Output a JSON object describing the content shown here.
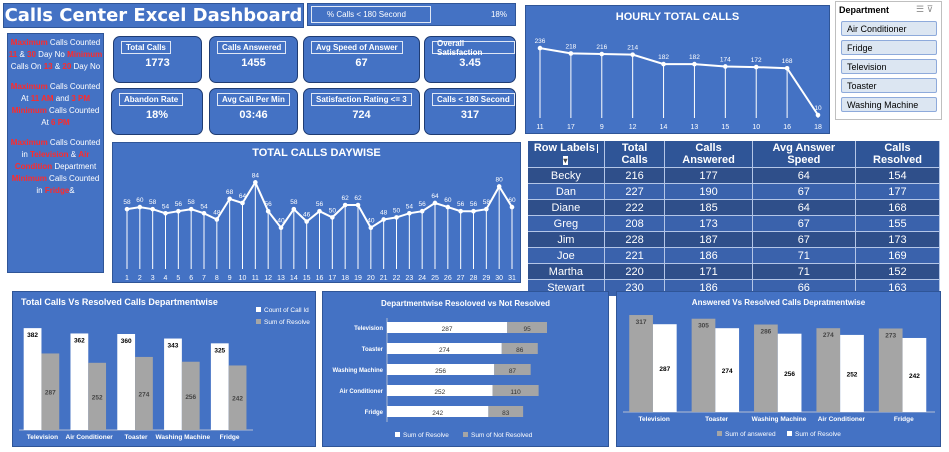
{
  "title": "Calls Center Excel Dashboard",
  "pct_bar": {
    "label": "% Calls < 180 Second",
    "value": "18%"
  },
  "notes": {
    "b1": [
      "Maximum",
      " Calls Counted ",
      "11",
      " & ",
      "30",
      " Day No ",
      "Minimum",
      " Calls On ",
      "13",
      " & ",
      "20",
      " Day No"
    ],
    "b2": [
      "Maximum",
      " Calls Counted At ",
      "11 AM",
      " and ",
      "3 PM",
      " ",
      "Minimum",
      " Calls Counted At ",
      "6 PM"
    ],
    "b3": [
      "Maximum",
      " Calls Counted in ",
      "Television",
      " & ",
      "Air Condition",
      " Department ",
      "Minimum",
      " Calls Counted in ",
      "Fridge",
      "&"
    ]
  },
  "kpis": [
    {
      "label": "Total Calls",
      "value": "1773"
    },
    {
      "label": "Calls Answered",
      "value": "1455"
    },
    {
      "label": "Avg Speed of Answer",
      "value": "67"
    },
    {
      "label": "Overall Satisfaction",
      "value": "3.45"
    },
    {
      "label": "Abandon Rate",
      "value": "18%"
    },
    {
      "label": "Avg Call Per Min",
      "value": "03:46"
    },
    {
      "label": "Satisfaction Rating <= 3",
      "value": "724"
    },
    {
      "label": "Calls < 180 Second",
      "value": "317"
    }
  ],
  "slicer": {
    "header": "Department",
    "items": [
      "Air Conditioner",
      "Fridge",
      "Television",
      "Toaster",
      "Washing Machine"
    ]
  },
  "pivot": {
    "headers": [
      "Row Labels",
      "Total Calls",
      "Calls Answered",
      "Avg Answer Speed",
      "Calls Resolved"
    ],
    "rows": [
      [
        "Becky",
        "216",
        "177",
        "64",
        "154"
      ],
      [
        "Dan",
        "227",
        "190",
        "67",
        "177"
      ],
      [
        "Diane",
        "222",
        "185",
        "64",
        "168"
      ],
      [
        "Greg",
        "208",
        "173",
        "67",
        "155"
      ],
      [
        "Jim",
        "228",
        "187",
        "67",
        "173"
      ],
      [
        "Joe",
        "221",
        "186",
        "71",
        "169"
      ],
      [
        "Martha",
        "220",
        "171",
        "71",
        "152"
      ],
      [
        "Stewart",
        "230",
        "186",
        "66",
        "163"
      ]
    ]
  },
  "chart_data": [
    {
      "type": "line",
      "title": "HOURLY TOTAL CALLS",
      "categories": [
        "11",
        "17",
        "9",
        "12",
        "14",
        "13",
        "15",
        "10",
        "16",
        "18"
      ],
      "values": [
        236,
        218,
        216,
        214,
        182,
        182,
        174,
        172,
        168,
        10
      ],
      "ylim": [
        0,
        260
      ],
      "colors": {
        "line": "#ffffff"
      }
    },
    {
      "type": "line",
      "title": "TOTAL CALLS DAYWISE",
      "categories": [
        "1",
        "2",
        "3",
        "4",
        "5",
        "6",
        "7",
        "8",
        "9",
        "10",
        "11",
        "12",
        "13",
        "14",
        "15",
        "16",
        "17",
        "18",
        "19",
        "20",
        "21",
        "22",
        "23",
        "24",
        "25",
        "26",
        "27",
        "28",
        "29",
        "30",
        "31"
      ],
      "values": [
        58,
        60,
        58,
        54,
        56,
        58,
        54,
        48,
        68,
        64,
        84,
        56,
        40,
        58,
        46,
        56,
        50,
        62,
        62,
        40,
        48,
        50,
        54,
        56,
        64,
        60,
        56,
        56,
        58,
        80,
        60
      ],
      "ylim": [
        0,
        95
      ]
    },
    {
      "type": "bar",
      "title": "Total Calls Vs Resolved Calls Departmentwise",
      "categories": [
        "Television",
        "Air Conditioner",
        "Toaster",
        "Washing Machine",
        "Fridge"
      ],
      "series": [
        {
          "name": "Count of Call Id",
          "values": [
            382,
            362,
            360,
            343,
            325
          ],
          "color": "#ffffff"
        },
        {
          "name": "Sum of Resolve",
          "values": [
            287,
            252,
            274,
            256,
            242
          ],
          "color": "#a5a5a5"
        }
      ],
      "ylim": [
        0,
        420
      ]
    },
    {
      "type": "bar",
      "orientation": "horizontal",
      "stacked": true,
      "title": "Departmentwise Resoloved vs Not Resolved",
      "categories": [
        "Television",
        "Toaster",
        "Washing Machine",
        "Air Conditioner",
        "Fridge"
      ],
      "series": [
        {
          "name": "Sum of Resolve",
          "values": [
            287,
            274,
            256,
            252,
            242
          ],
          "color": "#ffffff"
        },
        {
          "name": "Sum of Not Resolved",
          "values": [
            95,
            86,
            87,
            110,
            83
          ],
          "color": "#a5a5a5"
        }
      ]
    },
    {
      "type": "bar",
      "title": "Answered Vs Resolved Calls Depratmentwise",
      "categories": [
        "Television",
        "Toaster",
        "Washing Machine",
        "Air Conditioner",
        "Fridge"
      ],
      "series": [
        {
          "name": "Sum of answered",
          "values": [
            317,
            305,
            286,
            274,
            273
          ],
          "color": "#a5a5a5"
        },
        {
          "name": "Sum of Resolve",
          "values": [
            287,
            274,
            256,
            252,
            242
          ],
          "color": "#ffffff"
        }
      ],
      "ylim": [
        0,
        340
      ]
    }
  ]
}
